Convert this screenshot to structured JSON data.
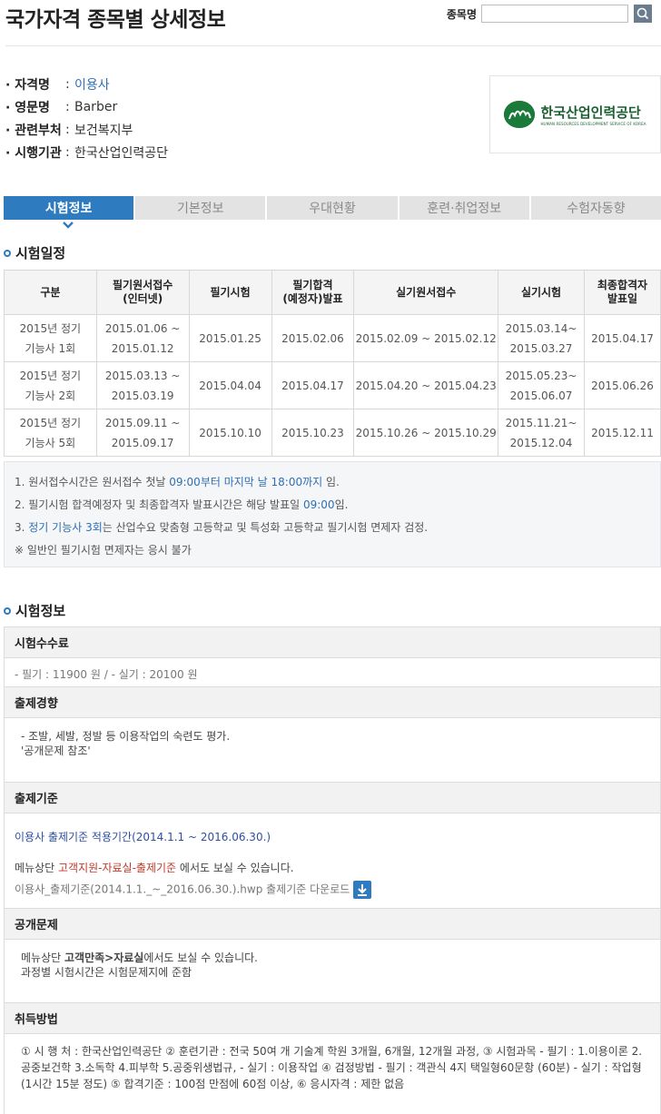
{
  "header": {
    "title": "국가자격 종목별 상세정보",
    "search_label": "종목명",
    "search_value": ""
  },
  "info": {
    "rows": [
      {
        "label": "· 자격명",
        "value": "이용사"
      },
      {
        "label": "· 영문명",
        "value": "Barber"
      },
      {
        "label": "· 관련부처",
        "value": "보건복지부"
      },
      {
        "label": "· 시행기관",
        "value": "한국산업인력공단"
      }
    ]
  },
  "logo": {
    "kr": "한국산업인력공단",
    "en": "HUMAN RESOURCES DEVELOPMENT SERVICE OF KOREA"
  },
  "tabs": [
    "시험정보",
    "기본정보",
    "우대현황",
    "훈련·취업정보",
    "수험자동향"
  ],
  "schedule": {
    "heading": "시험일정",
    "columns": [
      "구분",
      "필기원서접수\n(인터넷)",
      "필기시험",
      "필기합격\n(예정자)발표",
      "실기원서접수",
      "실기시험",
      "최종합격자\n발표일"
    ],
    "rows": [
      [
        "2015년 정기\n기능사 1회",
        "2015.01.06 ~\n2015.01.12",
        "2015.01.25",
        "2015.02.06",
        "2015.02.09 ~ 2015.02.12",
        "2015.03.14~\n2015.03.27",
        "2015.04.17"
      ],
      [
        "2015년 정기\n기능사 2회",
        "2015.03.13 ~\n2015.03.19",
        "2015.04.04",
        "2015.04.17",
        "2015.04.20 ~ 2015.04.23",
        "2015.05.23~\n2015.06.07",
        "2015.06.26"
      ],
      [
        "2015년 정기\n기능사 5회",
        "2015.09.11 ~\n2015.09.17",
        "2015.10.10",
        "2015.10.23",
        "2015.10.26 ~ 2015.10.29",
        "2015.11.21~\n2015.12.04",
        "2015.12.11"
      ]
    ]
  },
  "notes": {
    "n1_pre": "1. 원서접수시간은 원서접수 첫날 ",
    "n1_hl": "09:00부터 마지막 날 18:00까지",
    "n1_post": " 임.",
    "n2_pre": "2. 필기시험 합격예정자 및 최종합격자 발표시간은 해당 발표일 ",
    "n2_hl": "09:00",
    "n2_post": "임.",
    "n3_pre": "3. ",
    "n3_hl": "정기 기능사 3회",
    "n3_post": "는 산업수요 맞춤형 고등학교 및 특성화 고등학교 필기시험 면제자 검정.",
    "n4": "※ 일반인 필기시험 면제자는 응시 불가"
  },
  "exam_info": {
    "heading": "시험정보",
    "fee": {
      "title": "시험수수료",
      "text": "- 필기 : 11900 원 / - 실기 : 20100 원"
    },
    "trend": {
      "title": "출제경향",
      "line1": "- 조발, 세발, 정발 등 이용작업의 숙련도 평가.",
      "line2": "'공개문제 참조'"
    },
    "criteria": {
      "title": "출제기준",
      "line1": "이용사 출제기준 적용기간(2014.1.1 ~ 2016.06.30.)",
      "line2_pre": "메뉴상단 ",
      "line2_red": "고객지원-자료실-출제기준",
      "line2_post": " 에서도 보실 수 있습니다.",
      "file": "이용사_출제기준(2014.1.1._~_2016.06.30.).hwp 출제기준 다운로드"
    },
    "public": {
      "title": "공개문제",
      "line1_pre": "메뉴상단 ",
      "line1_bold": "고객만족>자료실",
      "line1_post": "에서도 보실 수 있습니다.",
      "line2": "과정별 시험시간은 시험문제지에 준함"
    },
    "method": {
      "title": "취득방법",
      "text": "① 시 행 처 : 한국산업인력공단 ② 훈련기관 : 전국 50여 개 기술계 학원 3개월, 6개월, 12개월 과정, ③ 시험과목 - 필기 : 1.이용이론 2.공중보건학 3.소독학 4.피부학 5.공중위생법규, - 실기 : 이용작업 ④ 검정방법 - 필기 : 객관식 4지 택일형60문항 (60분) - 실기 : 작업형 (1시간 15분 정도) ⑤ 합격기준 : 100점 만점에 60점 이상, ⑥ 응시자격 : 제한 없음"
    }
  }
}
